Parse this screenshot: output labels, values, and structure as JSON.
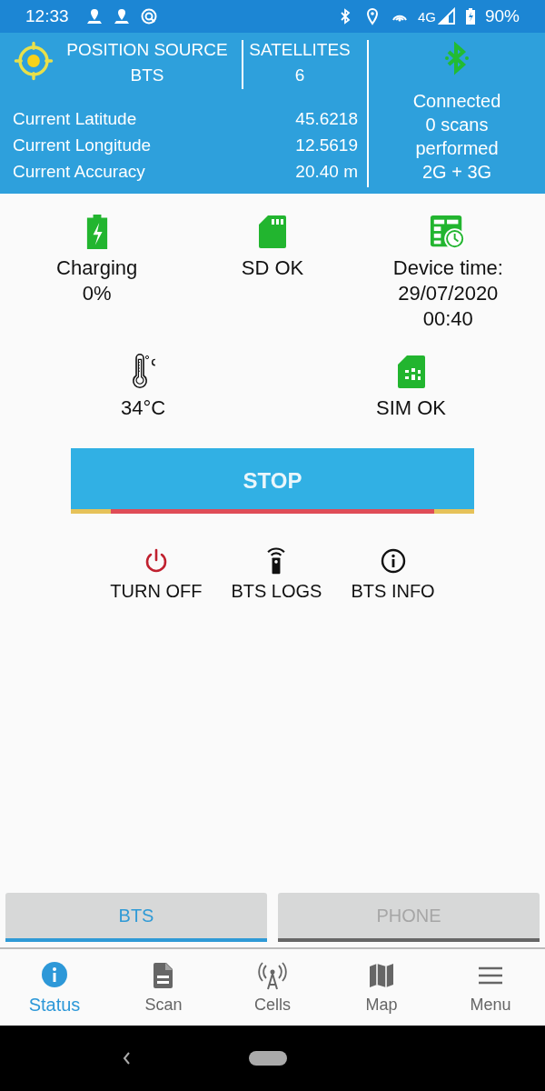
{
  "status_bar": {
    "time": "12:33",
    "network": "4G",
    "battery": "90%"
  },
  "header": {
    "position_source": {
      "label": "POSITION SOURCE",
      "value": "BTS"
    },
    "satellites": {
      "label": "SATELLITES",
      "value": "6"
    },
    "rows": [
      {
        "label": "Current Latitude",
        "value": "45.6218"
      },
      {
        "label": "Current Longitude",
        "value": "12.5619"
      },
      {
        "label": "Current Accuracy",
        "value": "20.40 m"
      }
    ],
    "connection": {
      "lines": [
        "Connected",
        "0 scans",
        "performed",
        "2G + 3G"
      ]
    }
  },
  "status_rows": [
    [
      {
        "kind": "battery",
        "lines": [
          "Charging",
          "0%"
        ]
      },
      {
        "kind": "sd",
        "lines": [
          "SD OK"
        ]
      },
      {
        "kind": "calendar",
        "lines": [
          "Device time:",
          "29/07/2020",
          "00:40"
        ]
      }
    ],
    [
      {
        "kind": "thermometer",
        "lines": [
          "34°C"
        ]
      },
      {
        "kind": "sim",
        "lines": [
          "SIM OK"
        ]
      }
    ]
  ],
  "stop_button": "STOP",
  "actions": [
    {
      "kind": "power",
      "label": "TURN OFF"
    },
    {
      "kind": "remote",
      "label": "BTS LOGS"
    },
    {
      "kind": "info",
      "label": "BTS INFO"
    }
  ],
  "tabs": [
    {
      "label": "BTS",
      "selected": true
    },
    {
      "label": "PHONE",
      "selected": false
    }
  ],
  "nav": [
    {
      "kind": "info",
      "label": "Status",
      "selected": true
    },
    {
      "kind": "doc",
      "label": "Scan",
      "selected": false
    },
    {
      "kind": "tower",
      "label": "Cells",
      "selected": false
    },
    {
      "kind": "map",
      "label": "Map",
      "selected": false
    },
    {
      "kind": "menu",
      "label": "Menu",
      "selected": false
    }
  ]
}
